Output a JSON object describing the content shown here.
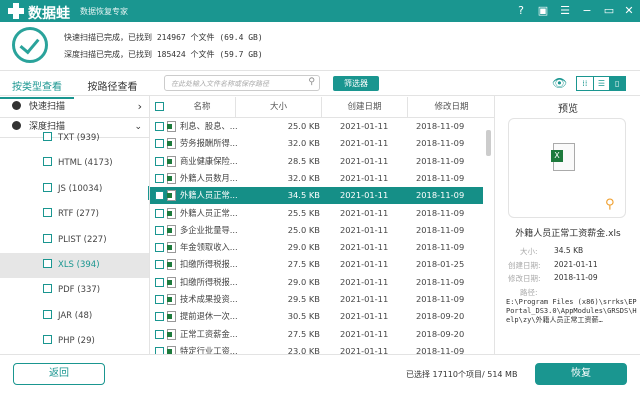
{
  "app": {
    "name": "数据蛙",
    "slogan": "数据恢复专家"
  },
  "window_buttons": [
    "help",
    "save",
    "menu",
    "minimize",
    "maximize",
    "close"
  ],
  "scan": {
    "quick": "快速扫描已完成，已找到 214967 个文件 (69.4 GB)",
    "deep": "深度扫描已完成，已找到 185424 个文件 (59.7 GB)"
  },
  "tabs": {
    "by_type": "按类型查看",
    "by_path": "按路径查看"
  },
  "search": {
    "placeholder": "在此处输入文件名称或保存路径"
  },
  "filter_label": "筛选器",
  "sidebar": {
    "quick": "快速扫描",
    "deep": "深度扫描",
    "categories": [
      "TXT (939)",
      "HTML (4173)",
      "JS (10034)",
      "RTF (277)",
      "PLIST (227)",
      "XLS (394)",
      "PDF (337)",
      "JAR (48)",
      "PHP (29)"
    ]
  },
  "table": {
    "headers": {
      "name": "名称",
      "size": "大小",
      "created": "创建日期",
      "modified": "修改日期"
    },
    "rows": [
      {
        "name": "利息、股息、...",
        "size": "25.0 KB",
        "created": "2021-01-11",
        "modified": "2018-11-09"
      },
      {
        "name": "劳务报酬所得...",
        "size": "32.0 KB",
        "created": "2021-01-11",
        "modified": "2018-11-09"
      },
      {
        "name": "商业健康保险...",
        "size": "28.5 KB",
        "created": "2021-01-11",
        "modified": "2018-11-09"
      },
      {
        "name": "外籍人员数月...",
        "size": "32.0 KB",
        "created": "2021-01-11",
        "modified": "2018-11-09"
      },
      {
        "name": "外籍人员正常...",
        "size": "34.5 KB",
        "created": "2021-01-11",
        "modified": "2018-11-09"
      },
      {
        "name": "外籍人员正常...",
        "size": "25.5 KB",
        "created": "2021-01-11",
        "modified": "2018-11-09"
      },
      {
        "name": "多企业批量导...",
        "size": "25.0 KB",
        "created": "2021-01-11",
        "modified": "2018-11-09"
      },
      {
        "name": "年金领取收入...",
        "size": "29.0 KB",
        "created": "2021-01-11",
        "modified": "2018-11-09"
      },
      {
        "name": "扣缴所得税报...",
        "size": "27.5 KB",
        "created": "2021-01-11",
        "modified": "2018-01-25"
      },
      {
        "name": "扣缴所得税报...",
        "size": "29.0 KB",
        "created": "2021-01-11",
        "modified": "2018-11-09"
      },
      {
        "name": "技术成果投资...",
        "size": "29.5 KB",
        "created": "2021-01-11",
        "modified": "2018-11-09"
      },
      {
        "name": "提前退休一次...",
        "size": "30.5 KB",
        "created": "2021-01-11",
        "modified": "2018-09-20"
      },
      {
        "name": "正常工资薪金...",
        "size": "27.5 KB",
        "created": "2021-01-11",
        "modified": "2018-09-20"
      },
      {
        "name": "特定行业工资...",
        "size": "23.0 KB",
        "created": "2021-01-11",
        "modified": "2018-11-09"
      }
    ]
  },
  "preview": {
    "title": "预览",
    "filename": "外籍人员正常工资薪金.xls",
    "size_label": "大小:",
    "size": "34.5 KB",
    "created_label": "创建日期:",
    "created": "2021-01-11",
    "modified_label": "修改日期:",
    "modified": "2018-11-09",
    "path_label": "路径:",
    "path": "E:\\Program Files (x86)\\srrks\\EPPortal_DS3.0\\AppModules\\GRSDS\\Help\\zy\\外籍人员正常工资薪…"
  },
  "footer": {
    "back": "返回",
    "selected": "已选择 17110个项目/ 514 MB",
    "recover": "恢复"
  },
  "colors": {
    "accent": "#1a9690"
  }
}
